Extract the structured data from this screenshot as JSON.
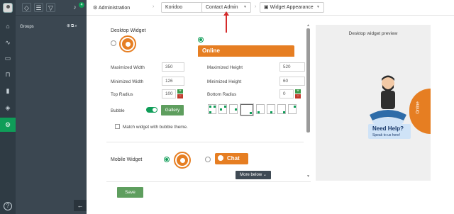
{
  "header": {
    "administration": "Administration",
    "project": "Koridoo",
    "section": "Contact Admin",
    "page": "Widget Appearance"
  },
  "panel": {
    "notification_count": "4",
    "groups_label": "Groups"
  },
  "desktop": {
    "title": "Desktop Widget",
    "online_label": "Online",
    "maximized_width_label": "Maximized Width",
    "maximized_width": "350",
    "maximized_height_label": "Maximized Height",
    "maximized_height": "520",
    "minimized_width_label": "Minimized Width",
    "minimized_width": "126",
    "minimized_height_label": "Minimized Height",
    "minimized_height": "60",
    "top_radius_label": "Top Radius",
    "top_radius": "100",
    "bottom_radius_label": "Bottom Radius",
    "bottom_radius": "0",
    "bubble_label": "Bubble",
    "gallery_label": "Gallery",
    "match_label": "Match widget with bubble theme."
  },
  "mobile": {
    "title": "Mobile Widget",
    "chat_label": "Chat"
  },
  "more_below": "More below",
  "save_label": "Save",
  "preview": {
    "title": "Desktop widget preview",
    "help_title": "Need Help?",
    "help_subtitle": "Speak to us here!",
    "tab_label": "Online"
  },
  "colors": {
    "accent": "#e67e22",
    "green": "#0f9d58",
    "sidebar": "#2f3b44"
  }
}
